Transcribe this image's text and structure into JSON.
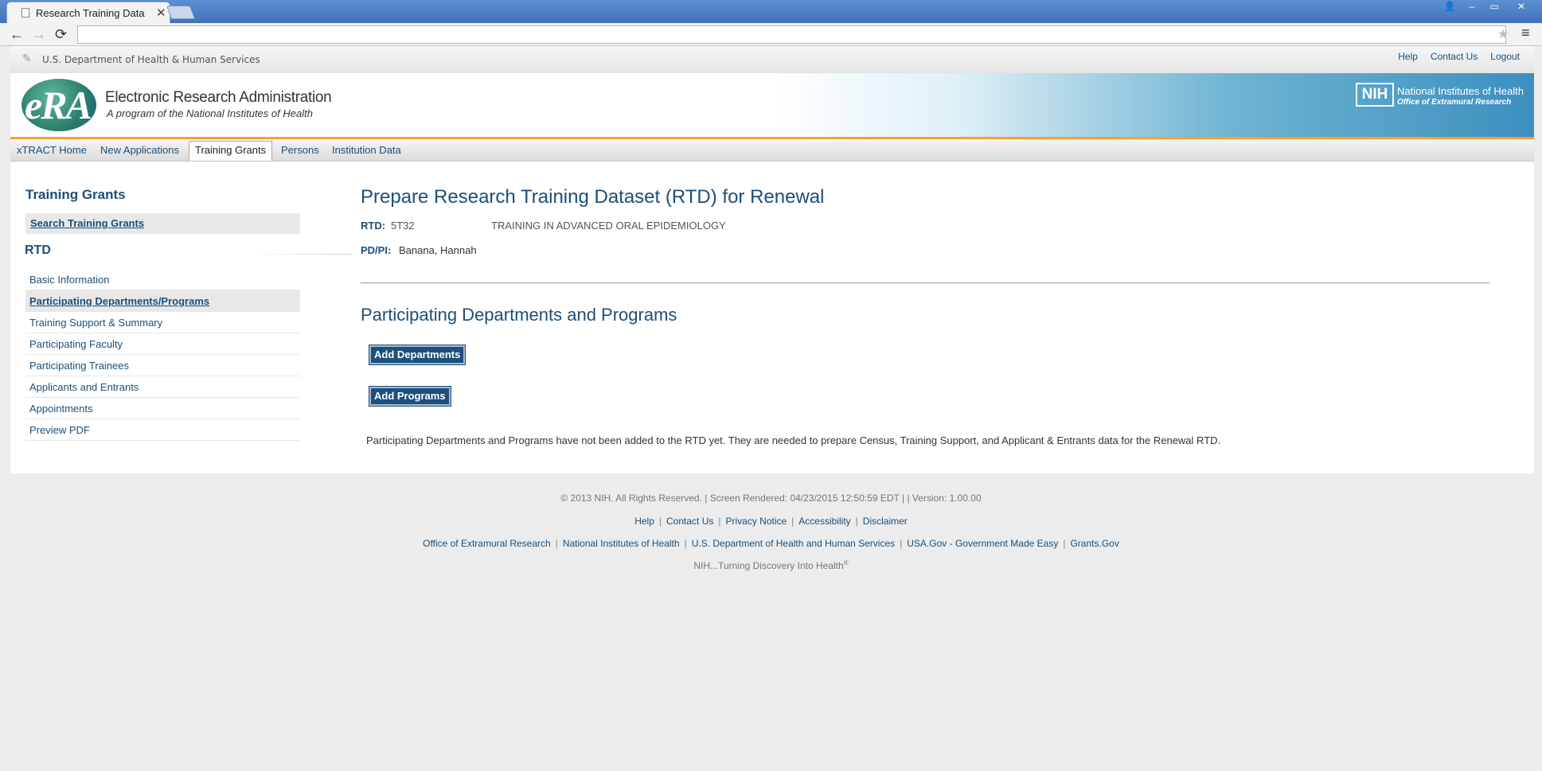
{
  "browser": {
    "tab_title": "Research Training Data",
    "tab_close": "✕",
    "back": "←",
    "forward": "→",
    "reload": "⟳",
    "star": "★",
    "menu": "≡",
    "window_controls": [
      "👤",
      "–",
      "▭",
      "✕"
    ]
  },
  "header": {
    "hhs_text": "U.S. Department of Health & Human Services",
    "top_links": [
      "Help",
      "Contact Us",
      "Logout"
    ],
    "era_logo_text": "eRA",
    "era_title": "Electronic Research Administration",
    "era_subtitle": "A program of the National Institutes of Health",
    "nih_logo": "NIH",
    "nih_name": "National Institutes of Health",
    "nih_office": "Office of  Extramural Research"
  },
  "nav": {
    "items": [
      "xTRACT Home",
      "New Applications",
      "Training Grants",
      "Persons",
      "Institution Data"
    ],
    "active": "Training Grants"
  },
  "sidebar": {
    "title": "Training Grants",
    "search_link": "Search Training Grants",
    "rtd_heading": "RTD",
    "items": [
      "Basic Information",
      "Participating Departments/Programs",
      "Training Support & Summary",
      "Participating Faculty",
      "Participating Trainees",
      "Applicants and Entrants",
      "Appointments",
      "Preview PDF"
    ],
    "active_item": "Participating Departments/Programs"
  },
  "main": {
    "title": "Prepare Research Training Dataset (RTD) for Renewal",
    "rtd_label": "RTD:",
    "rtd_value": "5T32",
    "rtd_title": "TRAINING IN ADVANCED ORAL EPIDEMIOLOGY",
    "pdpi_label": "PD/PI:",
    "pdpi_value": "Banana, Hannah",
    "section_title": "Participating Departments and Programs",
    "add_departments": "Add Departments",
    "add_programs": "Add Programs",
    "notice": "Participating Departments and Programs have not been added to the RTD yet. They are needed to prepare Census, Training Support, and Applicant & Entrants data for the Renewal RTD."
  },
  "footer": {
    "copyright": "© 2013 NIH. All Rights Reserved. | Screen Rendered: 04/23/2015 12:50:59 EDT | | Version: 1.00.00",
    "links1": [
      "Help",
      "Contact Us",
      "Privacy Notice",
      "Accessibility",
      "Disclaimer"
    ],
    "links2": [
      "Office of Extramural Research",
      "National Institutes of Health",
      "U.S. Department of Health and Human Services",
      "USA.Gov - Government Made Easy",
      "Grants.Gov"
    ],
    "tagline": "NIH...Turning Discovery Into Health",
    "tagline_mark": "®"
  }
}
